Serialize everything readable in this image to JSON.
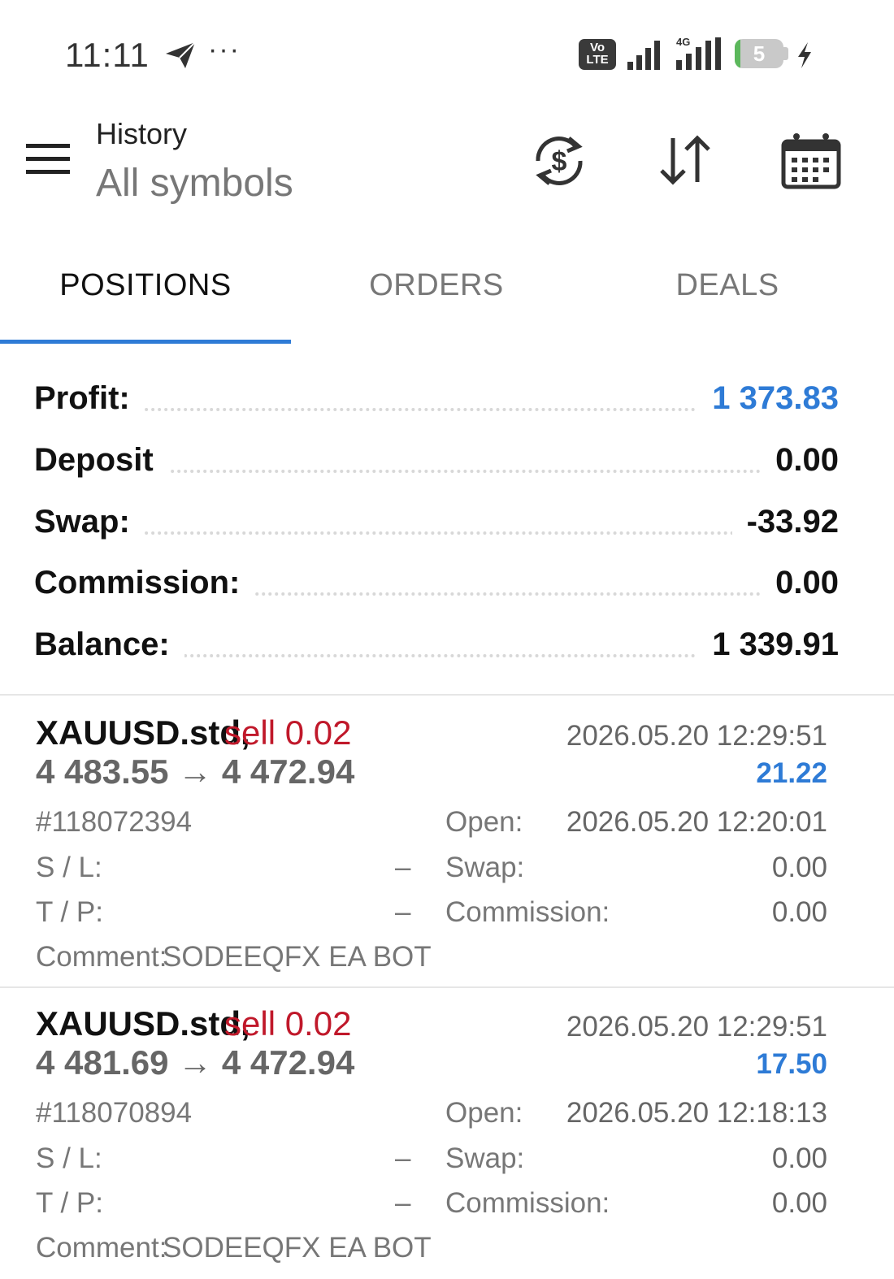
{
  "status_bar": {
    "time": "11:11",
    "dots": "···",
    "network_badge": "Vo LTE",
    "network_type": "4G",
    "battery_level": "5",
    "icons": [
      "telegram-send-icon",
      "more-dots-icon",
      "volte-icon",
      "signal-icon",
      "signal-4g-icon",
      "battery-icon",
      "charging-bolt-icon"
    ]
  },
  "header": {
    "title": "History",
    "subtitle": "All symbols",
    "icons": [
      "menu-icon",
      "currency-exchange-icon",
      "sort-icon",
      "calendar-icon"
    ]
  },
  "tabs": [
    {
      "label": "POSITIONS",
      "active": true
    },
    {
      "label": "ORDERS",
      "active": false
    },
    {
      "label": "DEALS",
      "active": false
    }
  ],
  "summary": {
    "profit": {
      "label": "Profit:",
      "value": "1 373.83"
    },
    "deposit": {
      "label": "Deposit",
      "value": "0.00"
    },
    "swap": {
      "label": "Swap:",
      "value": "-33.92"
    },
    "commission": {
      "label": "Commission:",
      "value": "0.00"
    },
    "balance": {
      "label": "Balance:",
      "value": "1 339.91"
    }
  },
  "labels": {
    "sl": "S / L:",
    "tp": "T / P:",
    "comment": "Comment:",
    "open": "Open:",
    "swap": "Swap:",
    "commission": "Commission:"
  },
  "positions": [
    {
      "symbol": "XAUUSD.std,",
      "side": "sell 0.02",
      "close_time": "2026.05.20 12:29:51",
      "prices": "4 483.55 → 4 472.94",
      "profit": "21.22",
      "ticket": "#118072394",
      "open_time": "2026.05.20 12:20:01",
      "sl": "–",
      "tp": "–",
      "swap": "0.00",
      "commission": "0.00",
      "comment": "SODEEQFX EA BOT"
    },
    {
      "symbol": "XAUUSD.std,",
      "side": "sell 0.02",
      "close_time": "2026.05.20 12:29:51",
      "prices": "4 481.69 → 4 472.94",
      "profit": "17.50",
      "ticket": "#118070894",
      "open_time": "2026.05.20 12:18:13",
      "sl": "–",
      "tp": "–",
      "swap": "0.00",
      "commission": "0.00",
      "comment": "SODEEQFX EA BOT"
    }
  ],
  "colors": {
    "accent_blue": "#2e7bd6",
    "sell_red": "#c0182a",
    "muted_text": "#777777"
  }
}
